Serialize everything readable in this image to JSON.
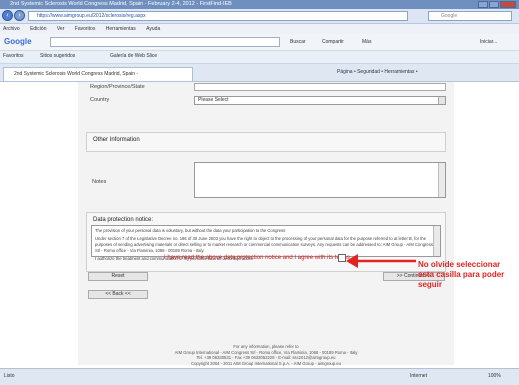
{
  "window": {
    "title": "2nd Systemic Sclerosis World Congress Madrid, Spain - February 2-4, 2012 - FirstFind-IEB"
  },
  "nav": {
    "address": "https://www.aimgroup.eu/2012/sclerosis/reg.aspx",
    "search_placeholder": "Google"
  },
  "menu": {
    "items": [
      "Archivo",
      "Edición",
      "Ver",
      "Favoritos",
      "Herramientas",
      "Ayuda"
    ]
  },
  "google_bar": {
    "logo": "Google",
    "search_label": "Buscar",
    "share_label": "Compartir",
    "more_label": "Más",
    "signin_label": "Iniciar..."
  },
  "favorites": {
    "label": "Favoritos",
    "items": [
      "Sitios sugeridos",
      "Galería de Web Slice"
    ]
  },
  "tab": {
    "label": "2nd Systemic Sclerosis World Congress Madrid, Spain -",
    "tools": "Página • Seguridad • Herramientas •"
  },
  "form": {
    "region_label": "Region/Province/State",
    "country_label": "Country",
    "country_value": "Please Select",
    "other_info_title": "Other Information",
    "notes_label": "Notes",
    "data_protection_title": "Data protection notice:",
    "dp_paragraph_1": "The provision of your personal data is voluntary, but without the data your participation to the Congress",
    "dp_paragraph_2": "Under section 7 of the Legislative Decree no. 196 of 30 June 2003 you have the right to object to the processing of your personal data for the purpose referred to at letter B, for the purposes of sending advertising materials or direct selling or to market research or commercial communication surveys. Any requests can be addressed to: AIM Group - AIM Congress Srl - Roma office - Via Flaminia, 1068 - 00189 Roma - Italy.",
    "dp_paragraph_3": "I authorize the treatment and communication of my personal data as described above",
    "agree_text": "I have read the above data protection notice and I agree with its terms",
    "reset_label": "Reset",
    "back_label": "<< Back <<",
    "continue_label": ">> Continue >>",
    "footer_lines": [
      "For any information, please refer to",
      "AIM Group International - AIM Congress Srl - Roma office, Via Flaminia, 1068 - 00189 Roma - Italy",
      "Tel. +39 06330531 - Fax +39 0633053229 - E-mail: ssc2012@aimgroup.eu",
      "Copyright 2004 - 2011 AIM Group International S.p.A. - AIM Group - aimgroup.eu"
    ]
  },
  "annotation": {
    "text": "No olvide seleccionar esta casilla para poder seguir",
    "color": "#e32222"
  },
  "status": {
    "left": "Listo",
    "zone": "Internet",
    "zoom": "100%"
  }
}
